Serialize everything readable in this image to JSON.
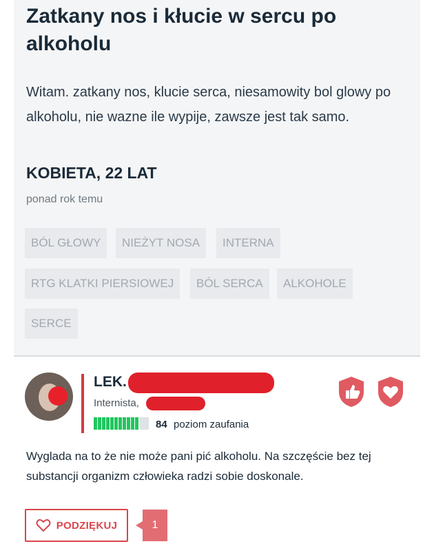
{
  "question": {
    "title": "Zatkany nos i kłucie w sercu po alkoholu",
    "body": "Witam. zatkany nos, klucie serca, niesamowity bol glowy po alkoholu, nie wazne ile wypije, zawsze jest tak samo.",
    "author": "KOBIETA, 22 LAT",
    "time": "ponad rok temu",
    "tags": [
      "BÓL GŁOWY",
      "NIEŻYT NOSA",
      "INTERNA",
      "RTG KLATKI PIERSIOWEJ",
      "BÓL SERCA",
      "ALKOHOLE",
      "SERCE"
    ]
  },
  "answer": {
    "doctor_prefix": "LEK.",
    "specialty": "Internista,",
    "trust_level": 84,
    "trust_label": "poziom zaufania",
    "text": "Wyglada na to że nie może pani pić alkoholu. Na szczęście bez tej substancji organizm człowieka radzi sobie doskonale.",
    "thanks_label": "PODZIĘKUJ",
    "thanks_count": "1"
  },
  "colors": {
    "accent": "#d9454d",
    "trust_green": "#22c55e",
    "tag_bg": "#e8eaed"
  }
}
